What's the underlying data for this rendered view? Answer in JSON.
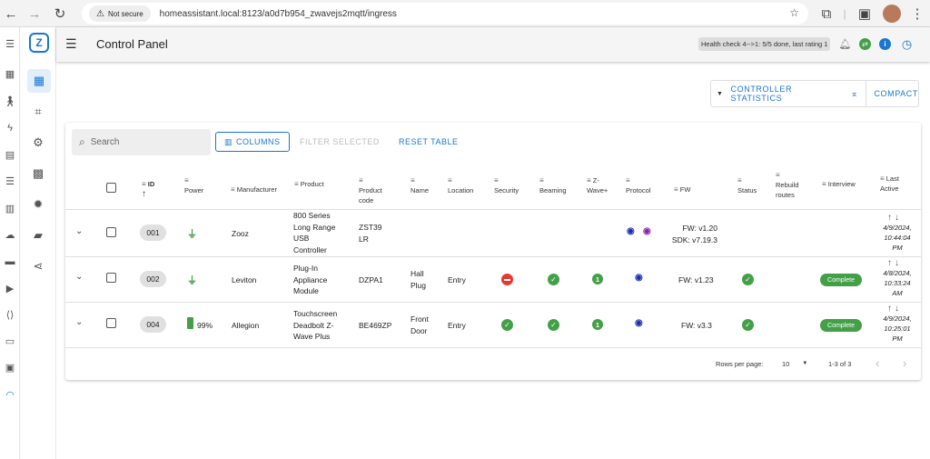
{
  "browser": {
    "not_secure": "Not secure",
    "url": "homeassistant.local:8123/a0d7b954_zwavejs2mqtt/ingress"
  },
  "header": {
    "title": "Control Panel",
    "health": "Health check 4-->1: 5/5 done, last rating 1"
  },
  "controller": {
    "stats_label": "CONTROLLER STATISTICS",
    "compact_label": "COMPACT"
  },
  "toolbar": {
    "search_placeholder": "Search",
    "columns_label": "COLUMNS",
    "filter_label": "FILTER SELECTED",
    "reset_label": "RESET TABLE"
  },
  "columns": {
    "id": "ID",
    "power": "Power",
    "manufacturer": "Manufacturer",
    "product": "Product",
    "product_code_1": "Product",
    "product_code_2": "code",
    "name": "Name",
    "location": "Location",
    "security": "Security",
    "beaming": "Beaming",
    "zwave_1": "Z-",
    "zwave_2": "Wave+",
    "protocol": "Protocol",
    "fw": "FW",
    "status": "Status",
    "rebuild_1": "Rebuild",
    "rebuild_2": "routes",
    "interview": "Interview",
    "last_active_1": "Last",
    "last_active_2": "Active"
  },
  "rows": [
    {
      "id": "001",
      "power": "",
      "manufacturer": "Zooz",
      "product": [
        "800 Series",
        "Long Range",
        "USB",
        "Controller"
      ],
      "product_code": [
        "ZST39",
        "LR"
      ],
      "name": [
        "",
        ""
      ],
      "location": "",
      "fw_1": "FW: v1.20",
      "fw_2": "SDK: v7.19.3",
      "interview": "",
      "last_active": [
        "4/9/2024,",
        "10:44:04",
        "PM"
      ]
    },
    {
      "id": "002",
      "power": "",
      "manufacturer": "Leviton",
      "product": [
        "Plug-In",
        "Appliance",
        "Module"
      ],
      "product_code": [
        "DZPA1"
      ],
      "name": [
        "Hall",
        "Plug"
      ],
      "location": "Entry",
      "zwave": "1",
      "fw_1": "FW: v1.23",
      "interview": "Complete",
      "last_active": [
        "4/8/2024,",
        "10:33:24",
        "AM"
      ]
    },
    {
      "id": "004",
      "power": "99%",
      "manufacturer": "Allegion",
      "product": [
        "Touchscreen",
        "Deadbolt Z-",
        "Wave Plus"
      ],
      "product_code": [
        "BE469ZP"
      ],
      "name": [
        "Front",
        "Door"
      ],
      "location": "Entry",
      "zwave": "1",
      "fw_1": "FW: v3.3",
      "interview": "Complete",
      "last_active": [
        "4/9/2024,",
        "10:25:01",
        "PM"
      ]
    }
  ],
  "footer": {
    "rows_per_page_label": "Rows per page:",
    "rows_per_page_value": "10",
    "range": "1-3 of 3"
  },
  "colors": {
    "accent": "#1976d2",
    "success": "#43a047",
    "error": "#e53935",
    "zwave_blue": "#1a2fb5",
    "zwave_purple": "#8e24aa"
  }
}
